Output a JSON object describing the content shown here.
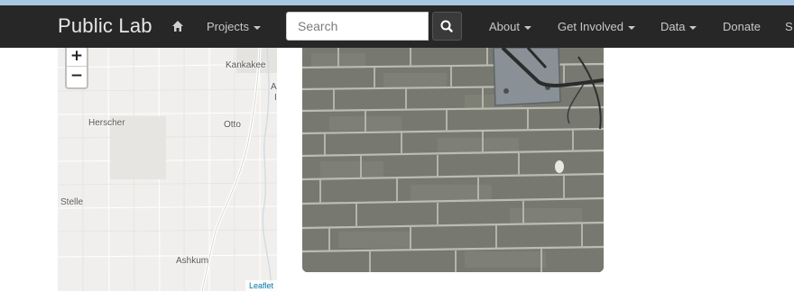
{
  "navbar": {
    "brand": "Public Lab",
    "items": [
      {
        "label": "Projects",
        "dropdown": true
      },
      {
        "label": "About",
        "dropdown": true
      },
      {
        "label": "Get Involved",
        "dropdown": true
      },
      {
        "label": "Data",
        "dropdown": true
      },
      {
        "label": "Donate",
        "dropdown": false
      },
      {
        "label": "S",
        "dropdown": false
      }
    ],
    "search": {
      "placeholder": "Search"
    }
  },
  "map": {
    "zoom_in": "+",
    "zoom_out": "−",
    "labels": [
      "Kankakee",
      "A",
      "I",
      "Herscher",
      "Otto",
      "Stelle",
      "Ashkum"
    ],
    "attribution": "Leaflet"
  },
  "colors": {
    "navbar_bg": "#272727",
    "topstrip": "#a9c6e3",
    "map_bg": "#f0efed",
    "link": "#0078a8"
  }
}
